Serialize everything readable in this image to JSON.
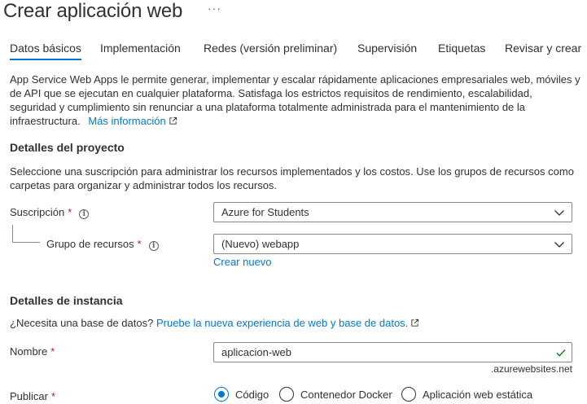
{
  "header": {
    "title": "Crear aplicación web",
    "more": "···"
  },
  "tabs": [
    {
      "label": "Datos básicos"
    },
    {
      "label": "Implementación"
    },
    {
      "label": "Redes (versión preliminar)"
    },
    {
      "label": "Supervisión"
    },
    {
      "label": "Etiquetas"
    },
    {
      "label": "Revisar y crear"
    }
  ],
  "intro": {
    "line1": "App Service Web Apps le permite generar, implementar y escalar rápidamente aplicaciones empresariales web, móviles y",
    "line2": "de API que se ejecutan en cualquier plataforma. Satisfaga los estrictos requisitos de rendimiento, escalabilidad,",
    "line3": "seguridad y cumplimiento sin renunciar a una plataforma totalmente administrada para el mantenimiento de la",
    "line4": "infraestructura.",
    "more_link": "Más información"
  },
  "project": {
    "heading": "Detalles del proyecto",
    "desc_line1": "Seleccione una suscripción para administrar los recursos implementados y los costos. Use los grupos de recursos como",
    "desc_line2": "carpetas para organizar y administrar todos los recursos.",
    "subscription_label": "Suscripción",
    "subscription_value": "Azure for Students",
    "resource_group_label": "Grupo de recursos",
    "resource_group_value": "(Nuevo) webapp",
    "create_new": "Crear nuevo",
    "required_mark": "*",
    "info_glyph": "i"
  },
  "instance": {
    "heading": "Detalles de instancia",
    "db_question": "¿Necesita una base de datos?",
    "db_link": "Pruebe la nueva experiencia de web y base de datos.",
    "name_label": "Nombre",
    "name_value": "aplicacion-web",
    "name_suffix": ".azurewebsites.net",
    "publish_label": "Publicar",
    "publish_options": [
      {
        "label": "Código",
        "selected": true
      },
      {
        "label": "Contenedor Docker",
        "selected": false
      },
      {
        "label": "Aplicación web estática",
        "selected": false
      }
    ]
  },
  "colors": {
    "accent": "#0078d4",
    "required": "#a4262c",
    "valid": "#107c10"
  },
  "icons": {
    "external": "external-link-icon",
    "chevron": "chevron-down-icon",
    "check": "checkmark-icon",
    "info": "info-icon"
  }
}
